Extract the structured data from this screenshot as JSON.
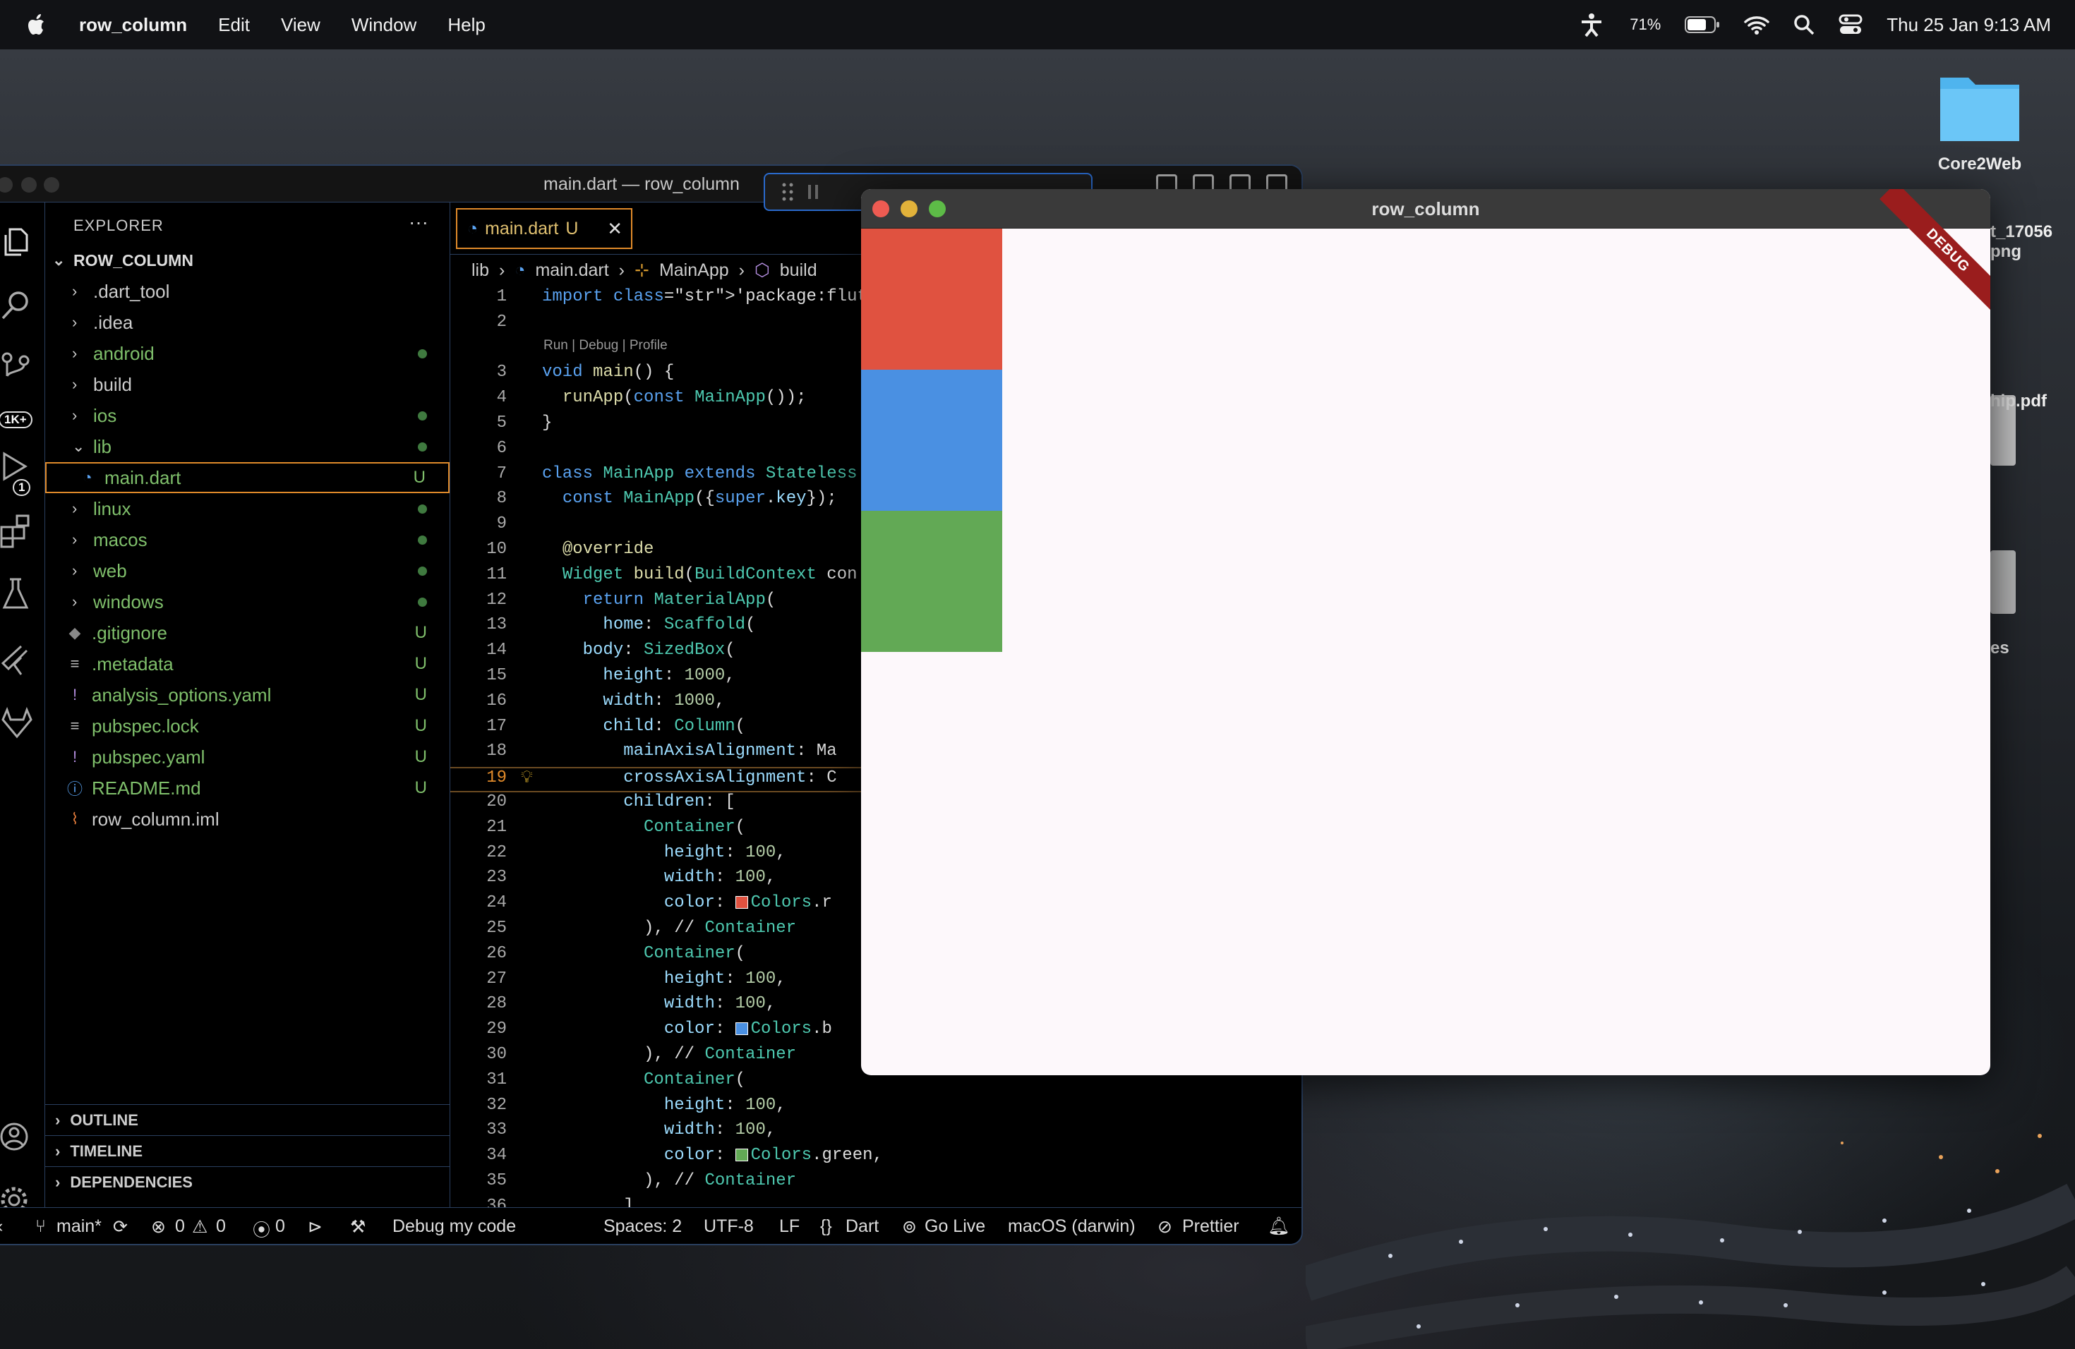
{
  "menubar": {
    "app": "row_column",
    "items": [
      "Edit",
      "View",
      "Window",
      "Help"
    ],
    "battery": "71%",
    "clock": "Thu 25 Jan  9:13 AM",
    "icons": [
      "apple-icon",
      "accessibility-icon",
      "battery-icon",
      "wifi-icon",
      "search-icon",
      "control-center-icon"
    ]
  },
  "desktop": {
    "folder": "Core2Web",
    "partial": [
      "t_17056",
      "png",
      "hip.pdf",
      "es"
    ]
  },
  "vscode": {
    "title": "main.dart — row_column",
    "explorer": {
      "header": "EXPLORER",
      "root": "ROW_COLUMN",
      "items": [
        {
          "label": ".dart_tool",
          "type": "folder",
          "status": ""
        },
        {
          "label": ".idea",
          "type": "folder",
          "status": ""
        },
        {
          "label": "android",
          "type": "folder",
          "status": "dot"
        },
        {
          "label": "build",
          "type": "folder",
          "status": ""
        },
        {
          "label": "ios",
          "type": "folder",
          "status": "dot"
        },
        {
          "label": "lib",
          "type": "folder-open",
          "status": "dot"
        },
        {
          "label": "main.dart",
          "type": "dart",
          "status": "U"
        },
        {
          "label": "linux",
          "type": "folder",
          "status": "dot"
        },
        {
          "label": "macos",
          "type": "folder",
          "status": "dot"
        },
        {
          "label": "web",
          "type": "folder",
          "status": "dot"
        },
        {
          "label": "windows",
          "type": "folder",
          "status": "dot"
        },
        {
          "label": ".gitignore",
          "type": "git",
          "status": "U"
        },
        {
          "label": ".metadata",
          "type": "text",
          "status": "U"
        },
        {
          "label": "analysis_options.yaml",
          "type": "yaml",
          "status": "U"
        },
        {
          "label": "pubspec.lock",
          "type": "text",
          "status": "U"
        },
        {
          "label": "pubspec.yaml",
          "type": "yaml",
          "status": "U"
        },
        {
          "label": "README.md",
          "type": "info",
          "status": "U"
        },
        {
          "label": "row_column.iml",
          "type": "rss",
          "status": ""
        }
      ],
      "sections": [
        "OUTLINE",
        "TIMELINE",
        "DEPENDENCIES"
      ]
    },
    "tab": {
      "label": "main.dart",
      "status": "U"
    },
    "breadcrumb": [
      "lib",
      "main.dart",
      "MainApp",
      "build"
    ],
    "codelens": "Run | Debug | Profile",
    "code": [
      {
        "n": "1",
        "t": "import 'package:flutter/materia"
      },
      {
        "n": "2",
        "t": ""
      },
      {
        "n": "3",
        "t": "void main() {"
      },
      {
        "n": "4",
        "t": "  runApp(const MainApp());"
      },
      {
        "n": "5",
        "t": "}"
      },
      {
        "n": "6",
        "t": ""
      },
      {
        "n": "7",
        "t": "class MainApp extends Stateless"
      },
      {
        "n": "8",
        "t": "  const MainApp({super.key});"
      },
      {
        "n": "9",
        "t": ""
      },
      {
        "n": "10",
        "t": "  @override"
      },
      {
        "n": "11",
        "t": "  Widget build(BuildContext con"
      },
      {
        "n": "12",
        "t": "    return MaterialApp("
      },
      {
        "n": "13",
        "t": "      home: Scaffold("
      },
      {
        "n": "14",
        "t": "    body: SizedBox("
      },
      {
        "n": "15",
        "t": "      height: 1000,"
      },
      {
        "n": "16",
        "t": "      width: 1000,"
      },
      {
        "n": "17",
        "t": "      child: Column("
      },
      {
        "n": "18",
        "t": "        mainAxisAlignment: Ma"
      },
      {
        "n": "19",
        "t": "        crossAxisAlignment: C"
      },
      {
        "n": "20",
        "t": "        children: ["
      },
      {
        "n": "21",
        "t": "          Container("
      },
      {
        "n": "22",
        "t": "            height: 100,"
      },
      {
        "n": "23",
        "t": "            width: 100,"
      },
      {
        "n": "24",
        "t": "            color: Colors.r"
      },
      {
        "n": "25",
        "t": "          ), // Container"
      },
      {
        "n": "26",
        "t": "          Container("
      },
      {
        "n": "27",
        "t": "            height: 100,"
      },
      {
        "n": "28",
        "t": "            width: 100,"
      },
      {
        "n": "29",
        "t": "            color: Colors.b"
      },
      {
        "n": "30",
        "t": "          ), // Container"
      },
      {
        "n": "31",
        "t": "          Container("
      },
      {
        "n": "32",
        "t": "            height: 100,"
      },
      {
        "n": "33",
        "t": "            width: 100,"
      },
      {
        "n": "34",
        "t": "            color: Colors.green,"
      },
      {
        "n": "35",
        "t": "          ), // Container"
      },
      {
        "n": "36",
        "t": "        ],"
      }
    ],
    "current_line": "19",
    "status": {
      "branch": "main*",
      "errors": "0",
      "warnings": "0",
      "ports": "0",
      "debug": "Debug my code",
      "spaces": "Spaces: 2",
      "encoding": "UTF-8",
      "eol": "LF",
      "lang": "Dart",
      "golive": "Go Live",
      "device": "macOS (darwin)",
      "prettier": "Prettier"
    },
    "badges": {
      "scm": "1K+",
      "debug": "1"
    }
  },
  "app": {
    "title": "row_column",
    "banner": "DEBUG",
    "boxes": [
      "#e05240",
      "#4a90e2",
      "#62a955"
    ]
  },
  "colors": {
    "accent": "#e08a2a",
    "border": "#2a3f5f"
  }
}
